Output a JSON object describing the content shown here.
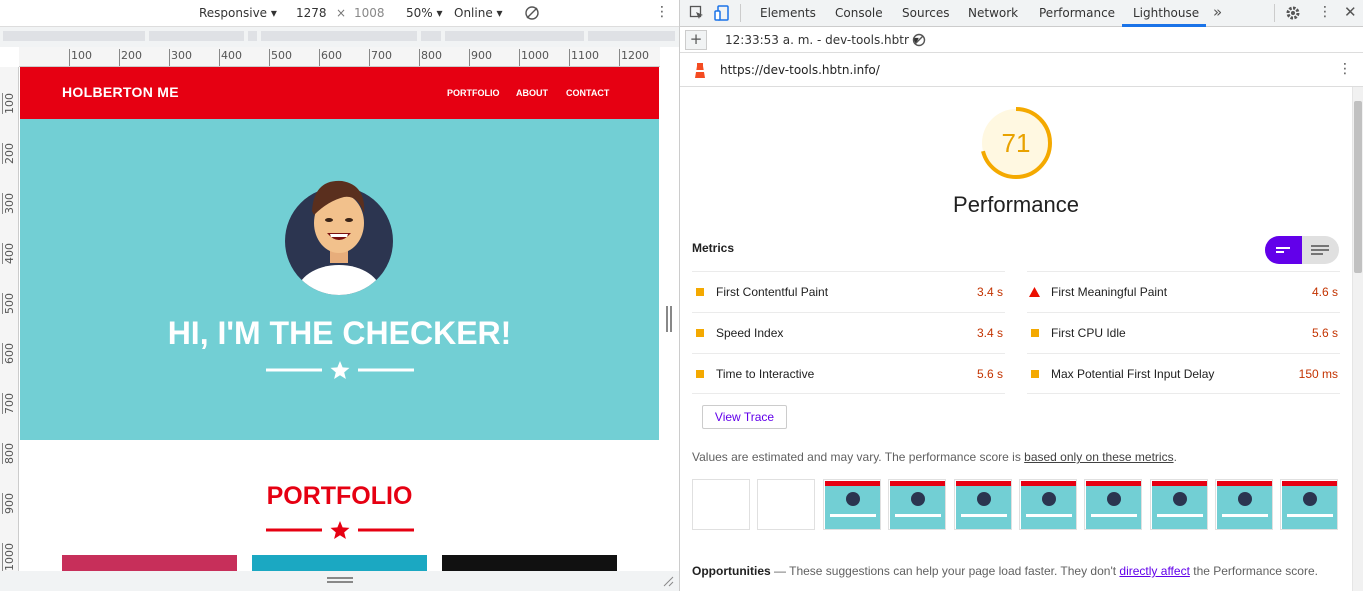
{
  "device_toolbar": {
    "device": "Responsive",
    "width": "1278",
    "times": "×",
    "height": "1008",
    "zoom": "50%",
    "network": "Online"
  },
  "ruler_top": [
    "100",
    "200",
    "300",
    "400",
    "500",
    "600",
    "700",
    "800",
    "900",
    "1000",
    "1100",
    "1200"
  ],
  "ruler_left": [
    "100",
    "200",
    "300",
    "400",
    "500",
    "600",
    "700",
    "800",
    "900",
    "1000"
  ],
  "site": {
    "brand": "HOLBERTON ME",
    "nav": [
      "PORTFOLIO",
      "ABOUT",
      "CONTACT"
    ],
    "hero_title": "HI, I'M THE CHECKER!",
    "section_title": "PORTFOLIO"
  },
  "devtools": {
    "tabs": [
      "Elements",
      "Console",
      "Sources",
      "Network",
      "Performance",
      "Lighthouse"
    ],
    "active_tab": "Lighthouse",
    "more": "»",
    "report_select": "12:33:53 a. m. - dev-tools.hbtr",
    "url": "https://dev-tools.hbtn.info/",
    "score": "71",
    "score_value": 0.71,
    "category": "Performance",
    "metrics_title": "Metrics",
    "metrics_left": [
      {
        "label": "First Contentful Paint",
        "value": "3.4 s"
      },
      {
        "label": "Speed Index",
        "value": "3.4 s"
      },
      {
        "label": "Time to Interactive",
        "value": "5.6 s"
      }
    ],
    "metrics_right": [
      {
        "label": "First Meaningful Paint",
        "value": "4.6 s"
      },
      {
        "label": "First CPU Idle",
        "value": "5.6 s"
      },
      {
        "label": "Max Potential First Input Delay",
        "value": "150 ms"
      }
    ],
    "view_trace": "View Trace",
    "note_prefix": "Values are estimated and may vary. The performance score is ",
    "note_link": "based only on these metrics",
    "note_suffix": ".",
    "opp_title": "Opportunities",
    "opp_dash": " — ",
    "opp_text": "These suggestions can help your page load faster. They don't ",
    "opp_link": "directly affect",
    "opp_suffix": " the Performance score."
  },
  "colors": {
    "brand_red": "#e60012",
    "hero_teal": "#72cfd4",
    "score_orange": "#f4a900",
    "metric_value": "#c33300",
    "accent_purple": "#6200ea"
  }
}
